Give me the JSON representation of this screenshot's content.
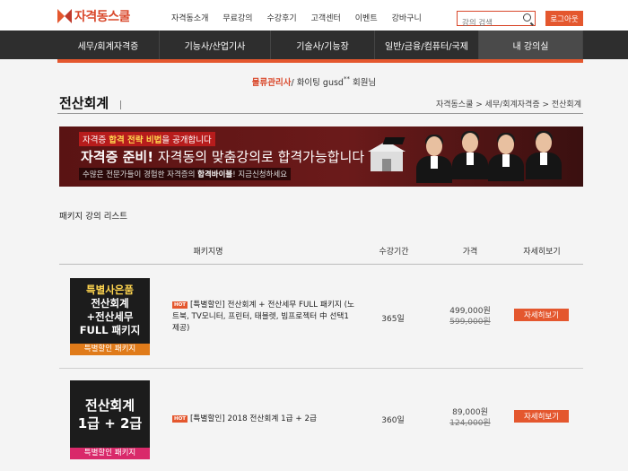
{
  "brand": {
    "name": "자격동스쿨"
  },
  "topnav": [
    "자격동소개",
    "무료강의",
    "수강후기",
    "고객센터",
    "이벤트",
    "강바구니"
  ],
  "search": {
    "placeholder": "강의 검색"
  },
  "logout_label": "로그아웃",
  "mainnav": [
    "세무/회계자격증",
    "기능사/산업기사",
    "기술사/기능장",
    "일반/금융/컴퓨터/국제",
    "내 강의실"
  ],
  "user": {
    "prefix": "물류관리사",
    "text": "/ 화이팅 gusd",
    "stars": "**",
    "suffix": "회원님"
  },
  "page": {
    "title": "전산회계",
    "breadcrumb": "자격동스쿨 > 세무/회계자격증 > 전산회계"
  },
  "banner": {
    "line1_pre": "자격증 ",
    "line1_hl": "합격 전략 비법",
    "line1_post": "을 공개합니다",
    "line2_bold": "자격증 준비!",
    "line2_rest": " 자격동의 맞춤강의로 합격가능합니다",
    "line3_pre": "수많은 전문가들이 경험한 자격증의 ",
    "line3_bold": "합격바이블",
    "line3_post": "! 지금신청하세요"
  },
  "list": {
    "title": "패키지 강의 리스트",
    "columns": [
      "패키지명",
      "수강기간",
      "가격",
      "자세히보기"
    ],
    "rows": [
      {
        "thumb_lines": [
          "특별사은품",
          "전산회계",
          "+전산세무",
          "FULL 패키지"
        ],
        "thumb_tag": "특별할인 패키지",
        "hot": "HOT",
        "name": "[특별할인] 전산회계 + 전산세무 FULL 패키지 (노트북, TV모니터, 프린터, 태블렛, 빔프로젝터 中 선택1 제공)",
        "period": "365일",
        "price": "499,000원",
        "old_price": "599,000원",
        "detail": "자세히보기"
      },
      {
        "thumb_lines": [
          "전산회계",
          "1급 + 2급"
        ],
        "thumb_tag": "특별할인 패키지",
        "hot": "HOT",
        "name": "[특별할인] 2018 전산회계 1급 + 2급",
        "period": "360일",
        "price": "89,000원",
        "old_price": "124,000원",
        "detail": "자세히보기"
      }
    ]
  },
  "colors": {
    "accent": "#e4572e",
    "nav": "#2e2e2e",
    "banner": "#6b1a1a",
    "tag1": "#e07b1a",
    "tag2": "#d9296a"
  }
}
